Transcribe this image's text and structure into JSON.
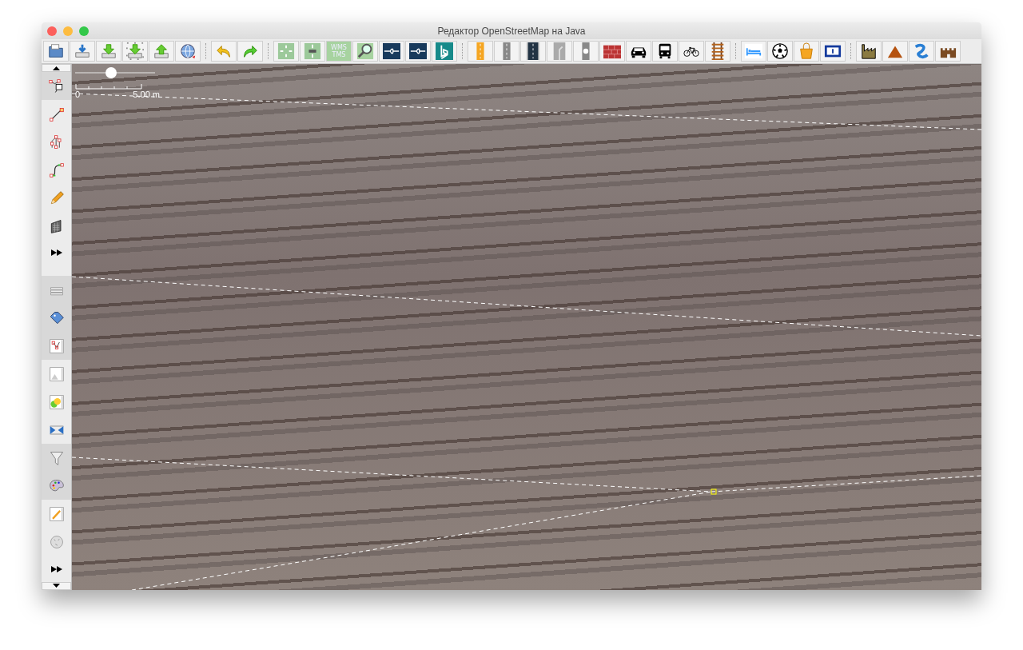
{
  "window": {
    "title": "Редактор OpenStreetMap на Java"
  },
  "toolbar": {
    "groups": [
      [
        {
          "kind": "open"
        },
        {
          "kind": "save"
        },
        {
          "kind": "download"
        },
        {
          "kind": "download-area"
        },
        {
          "kind": "upload"
        },
        {
          "kind": "globe"
        }
      ],
      [
        {
          "kind": "undo"
        },
        {
          "kind": "redo"
        }
      ],
      [
        {
          "kind": "zoom-all"
        },
        {
          "kind": "zoom-select"
        },
        {
          "kind": "imagery",
          "label_lines": [
            "WMS",
            "TMS"
          ]
        },
        {
          "kind": "magnifier"
        },
        {
          "kind": "link"
        },
        {
          "kind": "link"
        },
        {
          "kind": "bing"
        }
      ],
      [
        {
          "kind": "road-yellow"
        },
        {
          "kind": "road-grey"
        },
        {
          "kind": "road-dark"
        },
        {
          "kind": "road-turn"
        },
        {
          "kind": "signal"
        },
        {
          "kind": "wall"
        },
        {
          "kind": "car"
        },
        {
          "kind": "bus"
        },
        {
          "kind": "bicycle"
        },
        {
          "kind": "rail"
        }
      ],
      [
        {
          "kind": "bed"
        },
        {
          "kind": "ball"
        },
        {
          "kind": "bag"
        },
        {
          "kind": "sign"
        }
      ],
      [
        {
          "kind": "factory"
        },
        {
          "kind": "mountain"
        },
        {
          "kind": "river"
        },
        {
          "kind": "castle"
        }
      ]
    ]
  },
  "sidebar": {
    "mode_tools": [
      {
        "kind": "select",
        "selected": true
      },
      {
        "kind": "draw",
        "selected": false
      },
      {
        "kind": "split",
        "selected": false
      },
      {
        "kind": "improve",
        "selected": false
      },
      {
        "kind": "pencil",
        "selected": false
      },
      {
        "kind": "building",
        "selected": false
      }
    ],
    "dialog_toggles": [
      {
        "kind": "layers",
        "selected": true
      },
      {
        "kind": "tags",
        "selected": true
      },
      {
        "kind": "relations",
        "selected": true
      },
      {
        "kind": "selection",
        "selected": false
      },
      {
        "kind": "conflicts",
        "selected": false
      },
      {
        "kind": "validator",
        "selected": false
      },
      {
        "kind": "filter",
        "selected": true
      },
      {
        "kind": "styles",
        "selected": true
      },
      {
        "kind": "changeset",
        "selected": false
      },
      {
        "kind": "wiki",
        "selected": false
      }
    ]
  },
  "map": {
    "zoom_slider": {
      "level": 0.45
    },
    "scale": {
      "start": "0",
      "end": "5.00 m"
    }
  }
}
